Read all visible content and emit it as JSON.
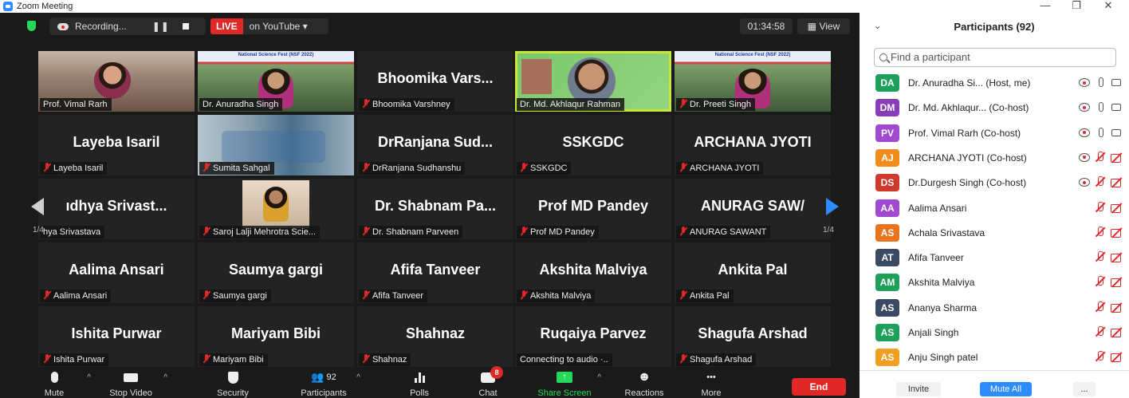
{
  "window": {
    "title": "Zoom Meeting"
  },
  "topbar": {
    "recording_label": "Recording...",
    "pause_label": "❚❚",
    "live_label": "LIVE",
    "live_platform": "on YouTube ▾",
    "elapsed_time": "01:34:58",
    "view_label": "View"
  },
  "tiles": [
    {
      "big": "",
      "name": "Prof. Vimal Rarh",
      "muted": false,
      "video": "office"
    },
    {
      "big": "",
      "name": "Dr. Anuradha Singh",
      "muted": false,
      "video": "banner",
      "banner_text": "National Science Fest (NSF 2022)"
    },
    {
      "big": "Bhoomika Vars...",
      "name": "Bhoomika Varshney",
      "muted": true
    },
    {
      "big": "",
      "name": "Dr. Md. Akhlaqur Rahman",
      "muted": false,
      "video": "green",
      "speaking": true
    },
    {
      "big": "",
      "name": "Dr. Preeti Singh",
      "muted": true,
      "video": "banner",
      "banner_text": "National Science Fest (NSF 2022)"
    },
    {
      "big": "Layeba Isaril",
      "name": "Layeba Isaril",
      "muted": true
    },
    {
      "big": "",
      "name": "Sumita Sahgal",
      "muted": true,
      "video": "curtain"
    },
    {
      "big": "DrRanjana Sud...",
      "name": "DrRanjana Sudhanshu",
      "muted": true
    },
    {
      "big": "SSKGDC",
      "name": "SSKGDC",
      "muted": true
    },
    {
      "big": "ARCHANA JYOTI",
      "name": "ARCHANA JYOTI",
      "muted": true
    },
    {
      "big": "ıdhya Srivast...",
      "name": "hya Srivastava",
      "muted": false
    },
    {
      "big": "",
      "name": "Saroj Lalji Mehrotra Scie...",
      "muted": true,
      "video": "saroj"
    },
    {
      "big": "Dr. Shabnam Pa...",
      "name": "Dr. Shabnam Parveen",
      "muted": true
    },
    {
      "big": "Prof MD Pandey",
      "name": "Prof MD Pandey",
      "muted": true
    },
    {
      "big": "ANURAG SAW/",
      "name": "ANURAG SAWANT",
      "muted": true
    },
    {
      "big": "Aalima Ansari",
      "name": "Aalima Ansari",
      "muted": true
    },
    {
      "big": "Saumya gargi",
      "name": "Saumya gargi",
      "muted": true
    },
    {
      "big": "Afifa Tanveer",
      "name": "Afifa Tanveer",
      "muted": true
    },
    {
      "big": "Akshita Malviya",
      "name": "Akshita Malviya",
      "muted": true
    },
    {
      "big": "Ankita Pal",
      "name": "Ankita Pal",
      "muted": true
    },
    {
      "big": "Ishita Purwar",
      "name": "Ishita Purwar",
      "muted": true
    },
    {
      "big": "Mariyam Bibi",
      "name": "Mariyam Bibi",
      "muted": true
    },
    {
      "big": "Shahnaz",
      "name": "Shahnaz",
      "muted": true
    },
    {
      "big": "Ruqaiya Parvez",
      "name": "Connecting to audio ·..",
      "muted": false
    },
    {
      "big": "Shagufa Arshad",
      "name": "Shagufa Arshad",
      "muted": true
    }
  ],
  "pager": {
    "left": "1/4",
    "right": "1/4"
  },
  "toolbar": {
    "mute": "Mute",
    "stop_video": "Stop Video",
    "security": "Security",
    "participants": "Participants",
    "participants_count": "92",
    "polls": "Polls",
    "chat": "Chat",
    "chat_badge": "8",
    "share_screen": "Share Screen",
    "reactions": "Reactions",
    "more": "More",
    "more_dots": "•••",
    "end": "End"
  },
  "panel": {
    "title": "Participants (92)",
    "search_placeholder": "Find a participant",
    "participants": [
      {
        "initials": "DA",
        "name": "Dr. Anuradha Si...  (Host, me)",
        "color": "#1fa05a",
        "rec": true,
        "mic": "on",
        "cam": "on"
      },
      {
        "initials": "DM",
        "name": "Dr. Md. Akhlaqur...  (Co-host)",
        "color": "#8a3db8",
        "rec": true,
        "mic": "on",
        "cam": "on"
      },
      {
        "initials": "PV",
        "name": "Prof. Vimal Rarh (Co-host)",
        "color": "#a04ad0",
        "rec": true,
        "mic": "on",
        "cam": "on"
      },
      {
        "initials": "AJ",
        "name": "ARCHANA JYOTI (Co-host)",
        "color": "#f08c1c",
        "rec": true,
        "mic": "off",
        "cam": "off"
      },
      {
        "initials": "DS",
        "name": "Dr.Durgesh Singh (Co-host)",
        "color": "#d03a2c",
        "rec": true,
        "mic": "off",
        "cam": "off"
      },
      {
        "initials": "AA",
        "name": "Aalima Ansari",
        "color": "#a04ad0",
        "rec": false,
        "mic": "off",
        "cam": "off"
      },
      {
        "initials": "AS",
        "name": "Achala Srivastava",
        "color": "#e8741c",
        "rec": false,
        "mic": "off",
        "cam": "off"
      },
      {
        "initials": "AT",
        "name": "Afifa Tanveer",
        "color": "#3a4a63",
        "rec": false,
        "mic": "off",
        "cam": "off"
      },
      {
        "initials": "AM",
        "name": "Akshita Malviya",
        "color": "#1fa05a",
        "rec": false,
        "mic": "off",
        "cam": "off"
      },
      {
        "initials": "AS",
        "name": "Ananya Sharma",
        "color": "#3a4a63",
        "rec": false,
        "mic": "off",
        "cam": "off"
      },
      {
        "initials": "AS",
        "name": "Anjali Singh",
        "color": "#1fa05a",
        "rec": false,
        "mic": "off",
        "cam": "off"
      },
      {
        "initials": "AS",
        "name": "Anju Singh patel",
        "color": "#f0a020",
        "rec": false,
        "mic": "off",
        "cam": "off"
      },
      {
        "initials": "",
        "name": "",
        "color": "#1fa05a",
        "rec": false,
        "mic": "none",
        "cam": "none"
      }
    ],
    "invite": "Invite",
    "mute_all": "Mute All",
    "more": "..."
  }
}
